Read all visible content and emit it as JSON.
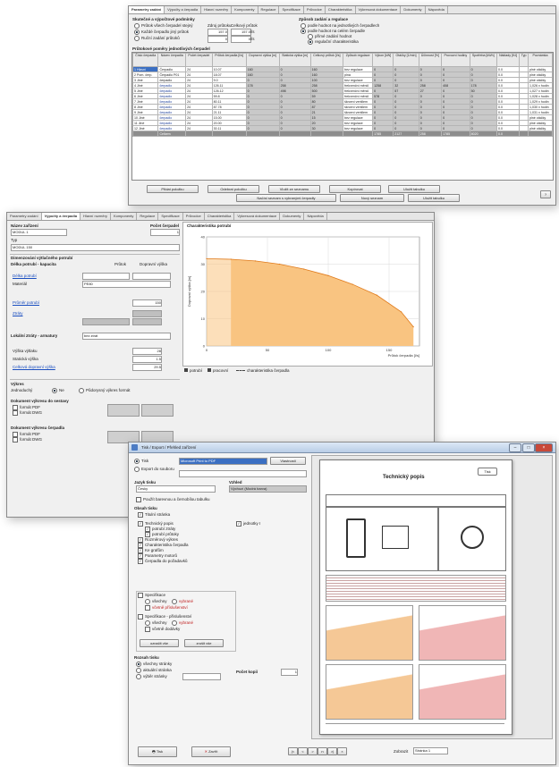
{
  "window1": {
    "tabs": [
      "Parametry zadání",
      "Výpočty a čerpadla",
      "Hlavní rozměry",
      "Komponenty",
      "Regulace",
      "Specifikace",
      "Průvodce",
      "Charakteristika",
      "Výkresová dokumentace",
      "Dokumenty",
      "Nápověda"
    ],
    "sec_left_title": "Skutečné a výpočtové podmínky",
    "opt1": "Průtok všech čerpadel stejný",
    "opt2": "Každé čerpadlo jiný průtok",
    "opt3": "Ruční zadání průtoků",
    "hdr_a": "Zdroj průtoku",
    "hdr_b": "Celkový průtok",
    "val_a1": "157.0",
    "val_b1": "157.0",
    "unit1": "l/s",
    "val_a2": "0",
    "val_b2": "0",
    "unit2": "l/s",
    "sec_right_title": "Způsob zadání a regulace",
    "r1": "podle hodnot na jednotlivých čerpadlech",
    "r2": "podle hodnot na celém čerpadle",
    "r3": "přímé zadání hodnot",
    "r4": "regulační charakteristika",
    "table_title": "Průtokové poměry jednotlivých čerpadel",
    "columns": [
      "Číslo čerpadla",
      "Název čerpadla",
      "Počet čerpadel",
      "Průtok čerpadla [l/s]",
      "Dopravní výška [m]",
      "Statická výška [m]",
      "Celkový průtok [l/s]",
      "Způsob regulace",
      "Výkon [kW]",
      "Otáčky [1/min]",
      "Účinnost [%]",
      "Provozní hodiny",
      "Spotřeba [kWh]",
      "Náklady [Kč]",
      "Typ",
      "Poznámka"
    ],
    "rows": [
      [
        "1 Hlavní",
        "Čerpadlo",
        "24",
        "10.07",
        "160",
        "0",
        "160",
        "bez regulace",
        "0",
        "0",
        "0",
        "0",
        "0",
        "0.0",
        "",
        "plné otáčky"
      ],
      [
        "2 Pom. čerp.",
        "Čerpadlo P01",
        "24",
        "18.07",
        "160",
        "0",
        "160",
        "plná",
        "0",
        "0",
        "0",
        "0",
        "0",
        "0.0",
        "",
        "plné otáčky"
      ],
      [
        "3 Jiné",
        "čerpadlo",
        "24",
        "9.0",
        "0",
        "0",
        "100",
        "bez regulace",
        "0",
        "0",
        "0",
        "0",
        "0",
        "0.0",
        "",
        "plné otáčky"
      ],
      [
        "4 Jiné",
        "čerpadlo",
        "24",
        "126.11",
        "178",
        "258",
        "258",
        "frekvenční měnič",
        "1258",
        "32",
        "258",
        "408",
        "178",
        "0.0",
        "",
        "1,026 x hodin"
      ],
      [
        "5 Jiné",
        "čerpadlo",
        "24",
        "126.12",
        "0",
        "498",
        "500",
        "frekvenční měnič",
        "0",
        "57",
        "27",
        "0",
        "50",
        "0.0",
        "",
        "1,027 x hodin"
      ],
      [
        "6 Jiné",
        "čerpadlo",
        "24",
        "59.8",
        "0",
        "0",
        "59",
        "frekvenční měnič",
        "578",
        "0",
        "0",
        "0",
        "0",
        "0.0",
        "",
        "1,028 x hodin"
      ],
      [
        "7 Jiné",
        "čerpadlo",
        "24",
        "80.11",
        "0",
        "0",
        "80",
        "škrcení ventilem",
        "0",
        "0",
        "0",
        "0",
        "0",
        "0.0",
        "",
        "1,029 x hodin"
      ],
      [
        "8 Jiné",
        "čerpadlo",
        "24",
        "87.78",
        "0",
        "0",
        "87",
        "škrcení ventilem",
        "0",
        "0",
        "0",
        "0",
        "0",
        "0.0",
        "",
        "1,030 x hodin"
      ],
      [
        "9 Jiné",
        "čerpadlo",
        "24",
        "21.11",
        "0",
        "0",
        "21",
        "škrcení ventilem",
        "0",
        "0",
        "0",
        "0",
        "0",
        "0.0",
        "",
        "1,031 x hodin"
      ],
      [
        "10 Jiné",
        "čerpadlo",
        "24",
        "15.00",
        "0",
        "0",
        "15",
        "bez regulace",
        "0",
        "0",
        "0",
        "0",
        "0",
        "0.0",
        "",
        "plné otáčky"
      ],
      [
        "11 Jiné",
        "čerpadlo",
        "24",
        "20.00",
        "0",
        "0",
        "20",
        "bez regulace",
        "0",
        "0",
        "0",
        "0",
        "0",
        "0.0",
        "",
        "plné otáčky"
      ],
      [
        "12 Jiné",
        "čerpadlo",
        "24",
        "30.11",
        "0",
        "0",
        "30",
        "bez regulace",
        "0",
        "0",
        "0",
        "0",
        "0",
        "0.0",
        "",
        "plné otáčky"
      ]
    ],
    "sum_row": [
      "",
      "Celkem",
      "",
      "",
      "",
      "",
      "",
      "",
      "1785",
      "2127",
      "258",
      "1785",
      "8020",
      "0.0",
      "",
      ""
    ],
    "btn1": "Přidat položku",
    "btn2": "Odebrat položku",
    "btn3": "Vložit ze seznamu",
    "btn4": "Kopírovat",
    "btn5": "Uložit tabulku",
    "btn6": "Načíst seznam s vybranými čerpadly",
    "btn7": "Nový seznam",
    "btn8": "Uložit tabulku",
    "corner": "?"
  },
  "window2": {
    "tabs": [
      "Parametry zadání",
      "Výpočty a čerpadla",
      "Hlavní rozměry",
      "Komponenty",
      "Regulace",
      "Specifikace",
      "Průvodce",
      "Charakteristika",
      "Výkresová dokumentace",
      "Dokumenty",
      "Nápověda"
    ],
    "lbl_name": "Název zařízení",
    "val_name": "MODUL 1",
    "lbl_count": "Počet čerpadel",
    "val_count": "1",
    "lbl_type": "Typ",
    "val_type": "MODUL 150",
    "sec1": "Dimenzování výtlačného potrubí",
    "sec1_l1": "Průtok",
    "sec1_l2": "Dopravní výška",
    "sec2": "Délka potrubí - kapacita",
    "lbl_pipe": "Délka potrubí",
    "lbl_mat": "Materiál",
    "val_mat": "PE80",
    "lbl_dn": "Průměr potrubí",
    "val_dn": "150",
    "lbl_loss": "Ztráty",
    "sec3": "Lokální ztráty - armatury",
    "val_sec3": "bez ztrát",
    "lbl_h": "Výška výtlaku",
    "val_h": "28",
    "lbl_stat": "Statická výška",
    "val_stat": "1.5",
    "lbl_total": "Celková dopravní výška",
    "val_total": "29.5",
    "sec4": "Výkres",
    "r_a": "Jednoduchý",
    "r_b": "Ne",
    "r_c": "Půdorysný výkres formát",
    "sec5": "Dokument výkresu do sestavy",
    "chk1": "formát PDF",
    "chk2": "formát DWG",
    "sec6": "Dokument výkresu čerpadla",
    "chk3": "formát PDF",
    "chk4": "formát DWG",
    "chart_title": "Charakteristika potrubí",
    "legend1": "potrubí",
    "legend2": "pracovní",
    "legend3": "charakteristika čerpadla",
    "xlabel": "Průtok čerpadla [l/s]",
    "ylabel": "Dopravní výška [m]"
  },
  "window3": {
    "title": "Tisk / Export / Přehled zařízení",
    "r_print": "Tisk",
    "val_printer": "Microsoft Print to PDF",
    "btn_settings": "Vlastnosti",
    "r_file": "Export do souboru",
    "lbl_lang": "Jazyk tisku",
    "val_lang": "Česky",
    "lbl_style": "Vzhled",
    "val_style": "Výchozí (Modrá barva)",
    "chk_color": "Použít barevnou a černobílou tabulku",
    "sec_content": "Obsah tisku",
    "chk_title": "Titulní stránka",
    "chk_tech": "Technický popis",
    "chk_tech1": "potrubí ztráty",
    "chk_tech2": "potrubí průtoky",
    "chk_pipe": "Rozměrový výkres",
    "chk_dim": "Charakteristika čerpadla",
    "chk_graph": "Ke grafům",
    "chk_elect": "Parametry motorů",
    "chk_spec": "Čerpadla do požadavků",
    "chk_unit": "jednotky I",
    "sec_spec": "Specifikace",
    "spec_a": "všechny",
    "spec_b": "vybrané",
    "spec_c": "včetně příslušenství",
    "sec_spec2": "Specifikace - příslušenství",
    "spec2_a": "všechny",
    "spec2_b": "vybrané",
    "spec2_c": "včetně dodávky",
    "btn_all": "označit vše",
    "btn_none": "zrušit vše",
    "sec_range": "Rozsah tisku",
    "range_a": "všechny stránky",
    "range_b": "aktuální stránka",
    "range_c": "výběr stránky",
    "lbl_copies": "Počet kopií",
    "val_copies": "1",
    "btn_print": "Tisk",
    "btn_close": "Zavřít",
    "lbl_zoom": "Zobrazit",
    "val_zoom": "Stránka 1",
    "preview_title": "Technický popis",
    "preview_btn": "Tisk",
    "nav_btns": [
      "|<",
      "<",
      ">",
      "n",
      ">|",
      "×"
    ]
  },
  "chart_data": {
    "type": "area",
    "title": "Charakteristika potrubí",
    "xlabel": "Průtok čerpadla [l/s]",
    "ylabel": "Dopravní výška [m]",
    "x": [
      0,
      20,
      40,
      60,
      80,
      100,
      120,
      140,
      160,
      170
    ],
    "y": [
      32,
      31.8,
      31.2,
      30.0,
      28.2,
      25.8,
      22.6,
      18.6,
      12.5,
      7
    ],
    "xlim": [
      0,
      175
    ],
    "ylim": [
      0,
      40
    ],
    "x_ticks": [
      "0",
      "50",
      "100",
      "150",
      "200"
    ],
    "y_ticks": [
      "0",
      "10",
      "20",
      "30",
      "40"
    ],
    "grid": true,
    "fill_color": "#f9c481"
  }
}
